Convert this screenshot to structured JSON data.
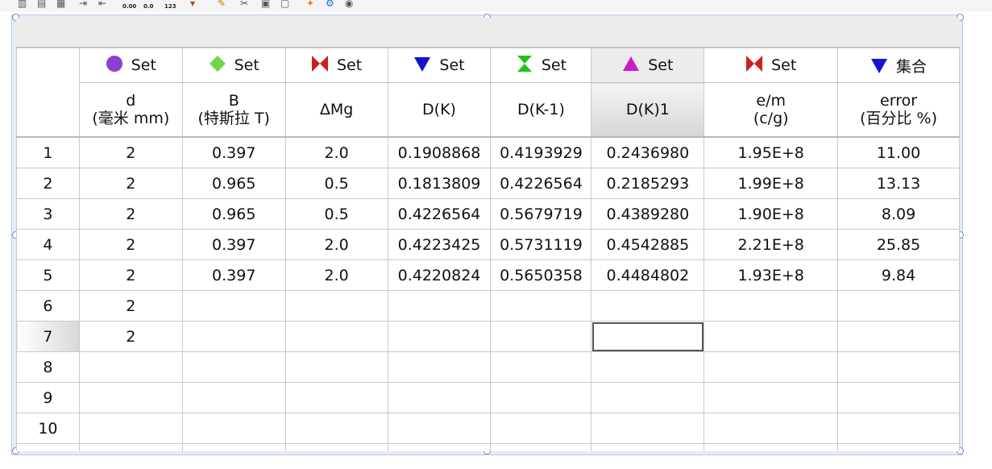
{
  "toolbar": {
    "icons": [
      "column-icon",
      "row-icon",
      "insert-icon",
      "indent-icon",
      "outdent-icon",
      "decrease-decimal-icon",
      "increase-decimal-icon",
      "number-format-icon",
      "formula-icon",
      "edit-icon",
      "tools-icon",
      "copy-icon",
      "paste-icon",
      "pin-icon",
      "gear-icon",
      "eye-icon"
    ],
    "dec_label_1": "0.00",
    "dec_label_2": "0.0",
    "num_label": "123"
  },
  "columns": [
    {
      "set_label": "Set",
      "symbol": "circle",
      "color": "#8c3fd1",
      "header": [
        "d",
        "(毫米 mm)"
      ]
    },
    {
      "set_label": "Set",
      "symbol": "diamond",
      "color": "#6fd64a",
      "header": [
        "B",
        "(特斯拉 T)"
      ]
    },
    {
      "set_label": "Set",
      "symbol": "bowtie",
      "color": "#cc1f1f",
      "header": [
        "ΔMg",
        ""
      ]
    },
    {
      "set_label": "Set",
      "symbol": "triangle-down",
      "color": "#1414cc",
      "header": [
        "D(K)",
        ""
      ]
    },
    {
      "set_label": "Set",
      "symbol": "hourglass",
      "color": "#1ec21e",
      "header": [
        "D(K-1)",
        ""
      ]
    },
    {
      "set_label": "Set",
      "symbol": "triangle-up",
      "color": "#c81ec8",
      "header": [
        "D(K)1",
        ""
      ]
    },
    {
      "set_label": "Set",
      "symbol": "bowtie",
      "color": "#cc1f1f",
      "header": [
        "e/m",
        "(c/g)"
      ]
    },
    {
      "set_label": "集合",
      "symbol": "triangle-down",
      "color": "#1414cc",
      "header": [
        "error",
        "(百分比 %)"
      ]
    }
  ],
  "rows": [
    {
      "num": "1",
      "cells": [
        "2",
        "0.397",
        "2.0",
        "0.1908868",
        "0.4193929",
        "0.2436980",
        "1.95E+8",
        "11.00"
      ]
    },
    {
      "num": "2",
      "cells": [
        "2",
        "0.965",
        "0.5",
        "0.1813809",
        "0.4226564",
        "0.2185293",
        "1.99E+8",
        "13.13"
      ]
    },
    {
      "num": "3",
      "cells": [
        "2",
        "0.965",
        "0.5",
        "0.4226564",
        "0.5679719",
        "0.4389280",
        "1.90E+8",
        "8.09"
      ]
    },
    {
      "num": "4",
      "cells": [
        "2",
        "0.397",
        "2.0",
        "0.4223425",
        "0.5731119",
        "0.4542885",
        "2.21E+8",
        "25.85"
      ]
    },
    {
      "num": "5",
      "cells": [
        "2",
        "0.397",
        "2.0",
        "0.4220824",
        "0.5650358",
        "0.4484802",
        "1.93E+8",
        "9.84"
      ]
    },
    {
      "num": "6",
      "cells": [
        "2",
        "",
        "",
        "",
        "",
        "",
        "",
        ""
      ]
    },
    {
      "num": "7",
      "cells": [
        "2",
        "",
        "",
        "",
        "",
        "",
        "",
        ""
      ]
    },
    {
      "num": "8",
      "cells": [
        "",
        "",
        "",
        "",
        "",
        "",
        "",
        ""
      ]
    },
    {
      "num": "9",
      "cells": [
        "",
        "",
        "",
        "",
        "",
        "",
        "",
        ""
      ]
    },
    {
      "num": "10",
      "cells": [
        "",
        "",
        "",
        "",
        "",
        "",
        "",
        ""
      ]
    }
  ],
  "selection": {
    "row": 7,
    "col": 6,
    "highlight_col": 6
  }
}
